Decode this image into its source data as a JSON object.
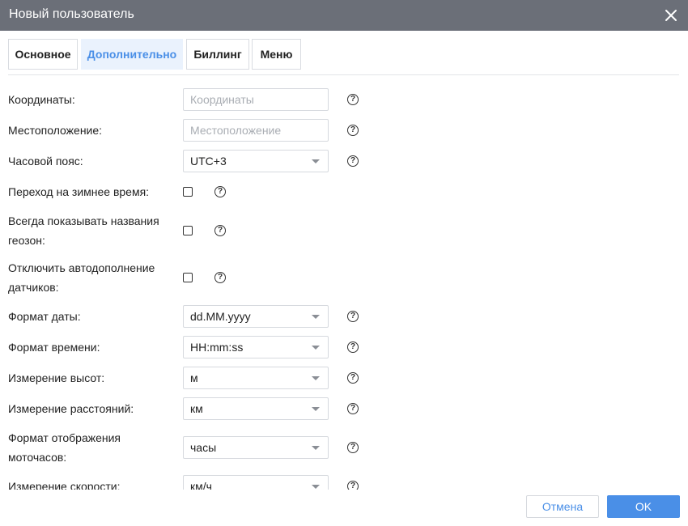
{
  "dialog": {
    "title": "Новый пользователь",
    "close_icon": "close-icon"
  },
  "tabs": [
    {
      "label": "Основное",
      "active": false
    },
    {
      "label": "Дополнительно",
      "active": true
    },
    {
      "label": "Биллинг",
      "active": false
    },
    {
      "label": "Меню",
      "active": false
    }
  ],
  "fields": {
    "coordinates": {
      "label": "Координаты:",
      "placeholder": "Координаты",
      "value": ""
    },
    "location": {
      "label": "Местоположение:",
      "placeholder": "Местоположение",
      "value": ""
    },
    "timezone": {
      "label": "Часовой пояс:",
      "value": "UTC+3"
    },
    "dst": {
      "label": "Переход на зимнее время:",
      "checked": false
    },
    "geozone_names": {
      "label_line1": "Всегда показывать названия",
      "label_line2": "геозон:",
      "checked": false
    },
    "sensor_autocomplete": {
      "label_line1": "Отключить автодополнение",
      "label_line2": "датчиков:",
      "checked": false
    },
    "date_format": {
      "label": "Формат даты:",
      "value": "dd.MM.yyyy"
    },
    "time_format": {
      "label": "Формат времени:",
      "value": "HH:mm:ss"
    },
    "altitude_unit": {
      "label": "Измерение высот:",
      "value": "м"
    },
    "distance_unit": {
      "label": "Измерение расстояний:",
      "value": "км"
    },
    "engine_hours_format": {
      "label_line1": "Формат отображения",
      "label_line2": "моточасов:",
      "value": "часы"
    },
    "speed_unit": {
      "label": "Измерение скорости:",
      "value": "км/ч"
    }
  },
  "help_glyph": "?",
  "footer": {
    "cancel_label": "Отмена",
    "ok_label": "OK"
  },
  "colors": {
    "titlebar": "#6b6f78",
    "accent": "#4a8fe7",
    "active_tab_bg": "#eaf2fd"
  }
}
